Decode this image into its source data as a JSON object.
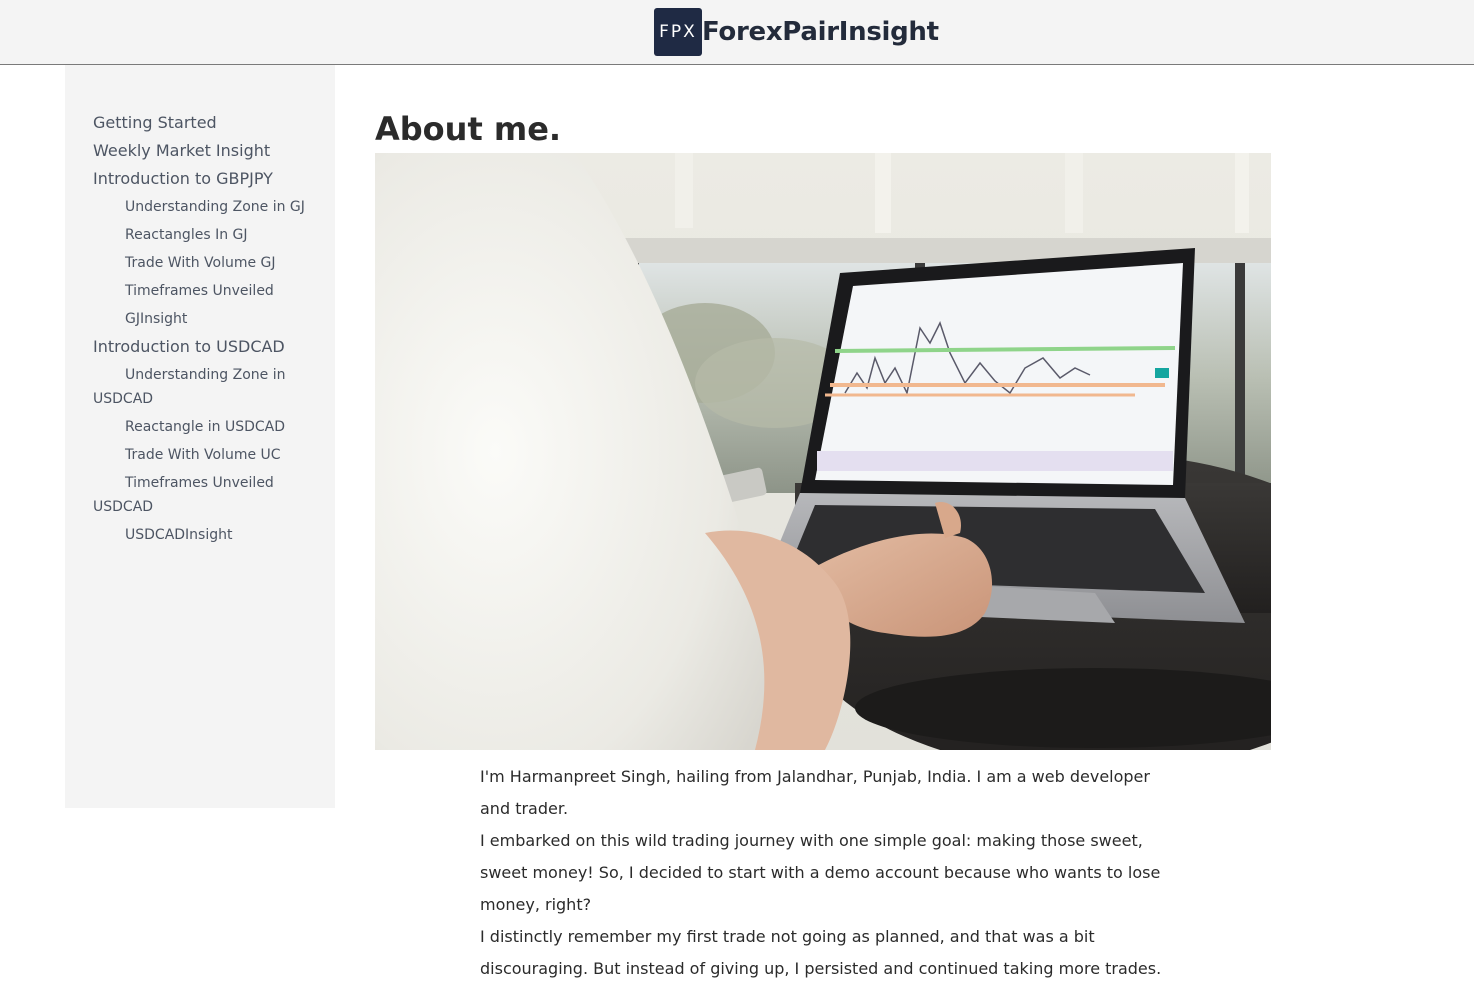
{
  "brand": {
    "logo_text": "FPX",
    "name": "ForexPairInsight"
  },
  "sidebar": {
    "items": [
      {
        "label": "Getting Started"
      },
      {
        "label": "Weekly Market Insight"
      },
      {
        "label": "Introduction to GBPJPY"
      },
      {
        "label": "Understanding Zone in GJ"
      },
      {
        "label": "Reactangles In GJ"
      },
      {
        "label": "Trade With Volume GJ"
      },
      {
        "label": "Timeframes Unveiled"
      },
      {
        "label": "GJInsight"
      },
      {
        "label": "Introduction to USDCAD"
      },
      {
        "label": "Understanding Zone in USDCAD"
      },
      {
        "label": "Reactangle in USDCAD"
      },
      {
        "label": "Trade With Volume UC"
      },
      {
        "label": "Timeframes Unveiled USDCAD"
      },
      {
        "label": "USDCADInsight"
      }
    ]
  },
  "main": {
    "title": "About me.",
    "paragraphs": [
      "I'm Harmanpreet Singh, hailing from Jalandhar, Punjab, India. I am a web developer and trader.",
      "I embarked on this wild trading journey with one simple goal: making those sweet, sweet money! So, I decided to start with a demo account because who wants to lose money, right?",
      "I distinctly remember my first trade not going as planned, and that was a bit discouraging. But instead of giving up, I persisted and continued taking more trades."
    ]
  },
  "colors": {
    "header_bg": "#f4f4f4",
    "logo_bg": "#1f2a44",
    "sidebar_bg": "#f4f4f4",
    "nav_text": "#4d5563"
  }
}
